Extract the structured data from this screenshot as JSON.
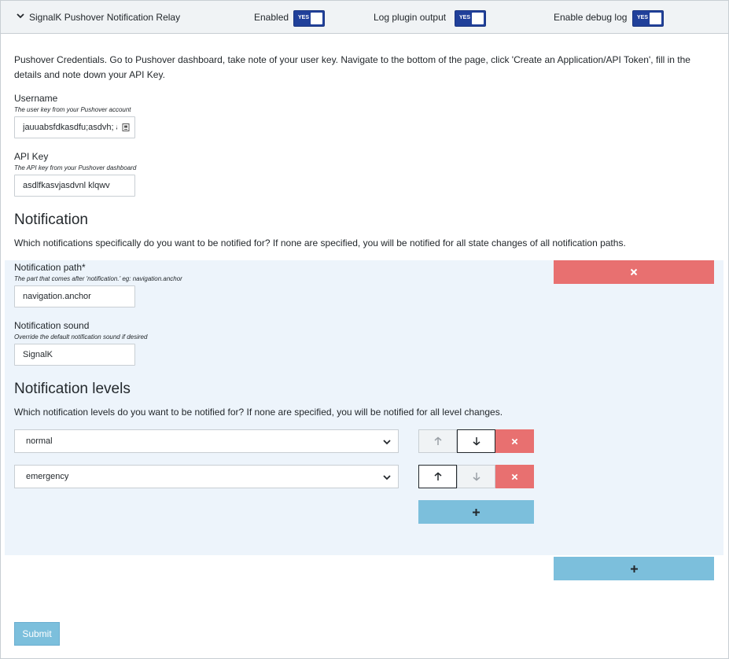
{
  "header": {
    "title": "SignalK Pushover Notification Relay",
    "enabled_label": "Enabled",
    "log_label": "Log plugin output",
    "debug_label": "Enable debug log",
    "toggle_text": "YES"
  },
  "intro": "Pushover Credentials. Go to Pushover dashboard, take note of your user key. Navigate to the bottom of the page, click 'Create an Application/API Token', fill in the details and note down your API Key.",
  "username": {
    "label": "Username",
    "help": "The user key from your Pushover account",
    "value": "jauuabsfdkasdfu;asdvh; as"
  },
  "api_key": {
    "label": "API Key",
    "help": "The API key from your Pushover dashboard",
    "value": "asdlfkasvjasdvnl klqwv"
  },
  "notification": {
    "heading": "Notification",
    "description": "Which notifications specifically do you want to be notified for? If none are specified, you will be notified for all state changes of all notification paths.",
    "path_label": "Notification path*",
    "path_help": "The part that comes after 'notification.' eg: navigation.anchor",
    "path_value": "navigation.anchor",
    "sound_label": "Notification sound",
    "sound_help": "Override the default notification sound if desired",
    "sound_value": "SignalK"
  },
  "levels": {
    "heading": "Notification levels",
    "description": "Which notification levels do you want to be notified for? If none are specified, you will be notified for all level changes.",
    "items": [
      "normal",
      "emergency"
    ]
  },
  "submit_label": "Submit",
  "colors": {
    "toggle": "#20409a",
    "danger": "#e87070",
    "add": "#7cbfdc",
    "panel": "#edf4fb"
  }
}
